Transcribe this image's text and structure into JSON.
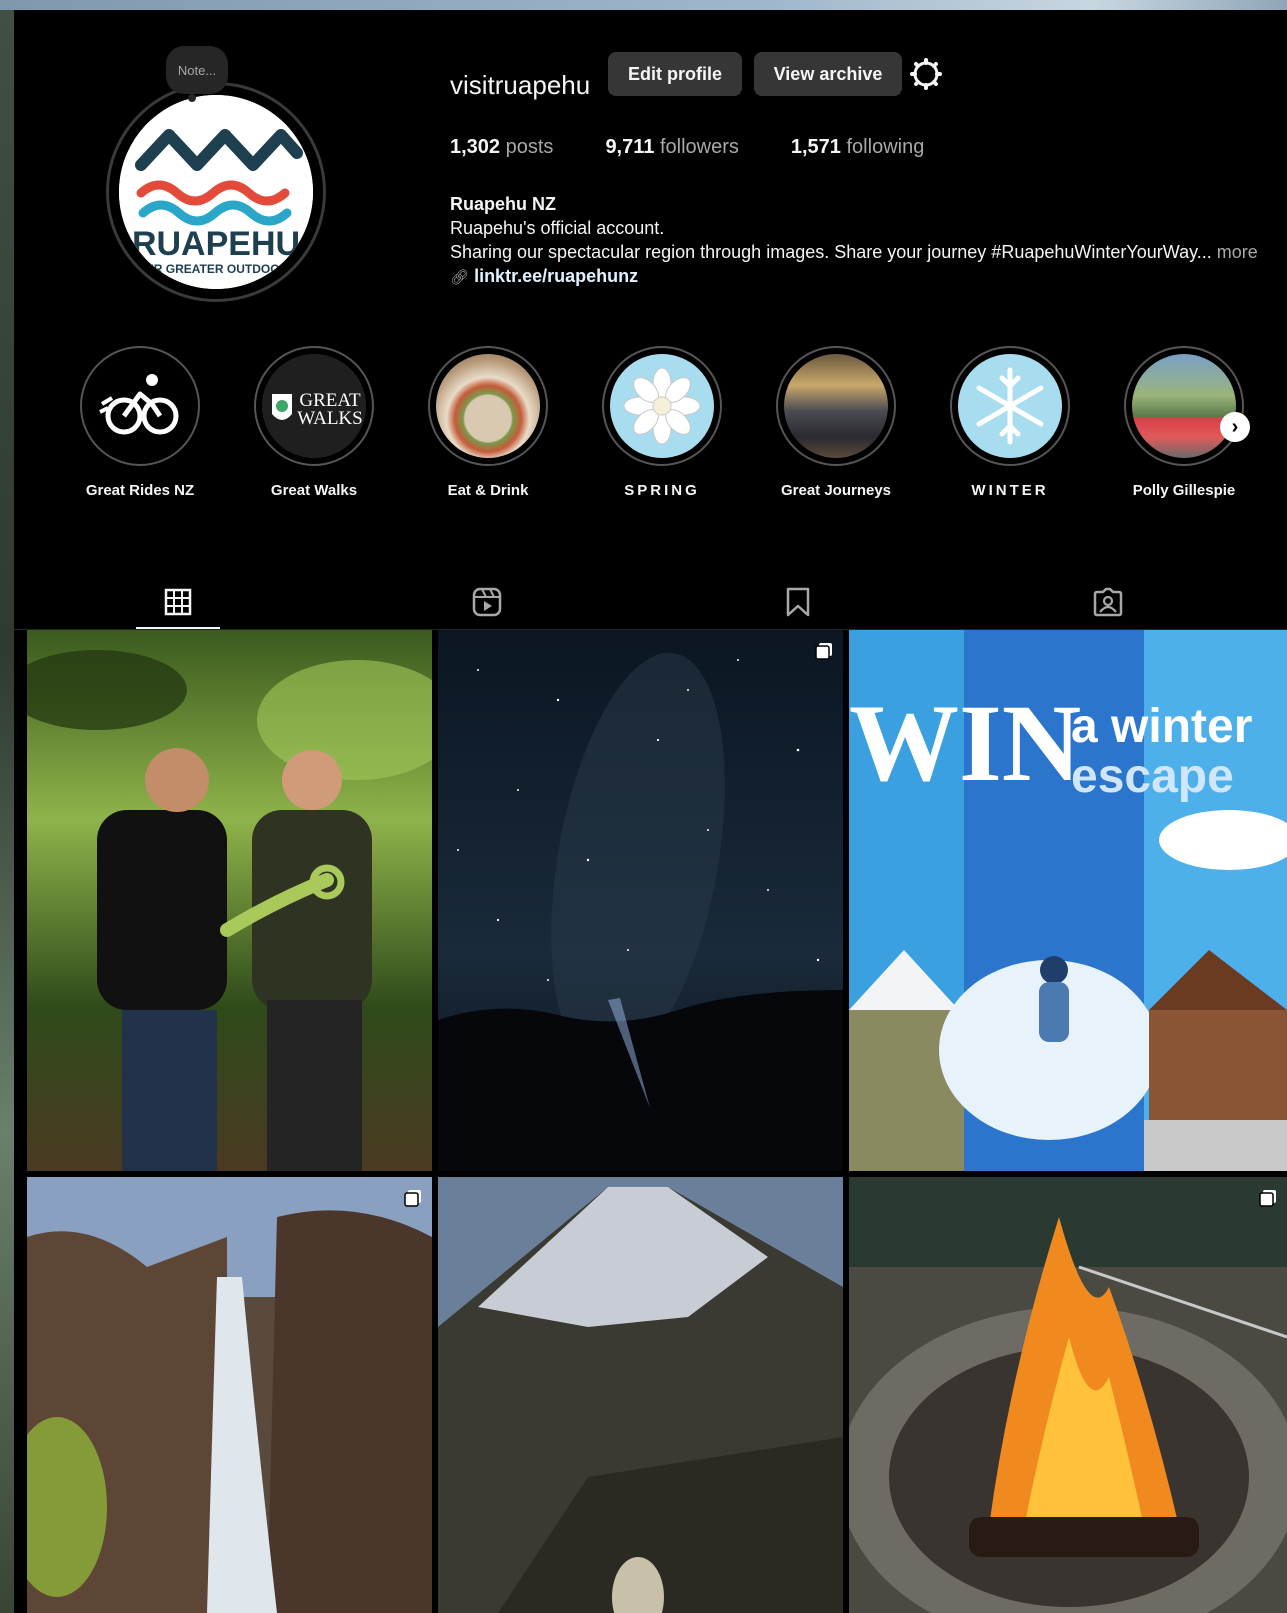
{
  "profile": {
    "note": "Note...",
    "username": "visitruapehu",
    "edit_profile": "Edit profile",
    "view_archive": "View archive",
    "stats": {
      "posts_count": "1,302",
      "posts_label": "posts",
      "followers_count": "9,711",
      "followers_label": "followers",
      "following_count": "1,571",
      "following_label": "following"
    },
    "bio": {
      "name": "Ruapehu NZ",
      "line1": "Ruapehu's official account.",
      "line2": "Sharing our spectacular region through images. Share your journey #RuapehuWinterYourWay...",
      "more": " more",
      "link": "linktr.ee/ruapehunz"
    },
    "logo": {
      "text": "RUAPEHU",
      "tagline": "OUR GREATER OUTDOORS"
    }
  },
  "highlights": [
    {
      "label": "Great Rides NZ"
    },
    {
      "label": "Great Walks",
      "logo_line1": "GREAT",
      "logo_line2": "WALKS"
    },
    {
      "label": "Eat & Drink"
    },
    {
      "label": "SPRING"
    },
    {
      "label": "Great Journeys"
    },
    {
      "label": "WINTER"
    },
    {
      "label": "Polly Gillespie"
    }
  ],
  "tabs": [
    {
      "name": "posts",
      "icon": "grid-icon",
      "active": true
    },
    {
      "name": "reels",
      "icon": "reels-icon"
    },
    {
      "name": "saved",
      "icon": "bookmark-icon"
    },
    {
      "name": "tagged",
      "icon": "tagged-icon"
    }
  ],
  "posts": {
    "win_text": "WIN",
    "win_sub1": "a winter",
    "win_sub2": "escape"
  },
  "colors": {
    "background": "#000000",
    "button": "#363636",
    "text": "#f5f5f5",
    "muted": "#a8a8a8"
  }
}
